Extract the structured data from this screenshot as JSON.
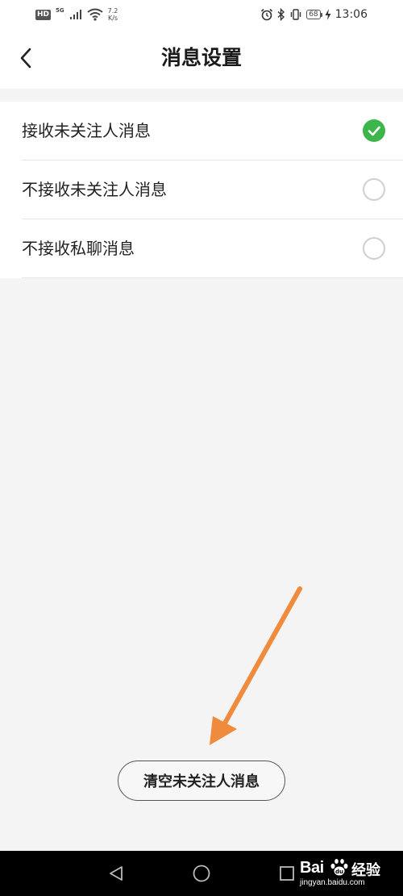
{
  "status_bar": {
    "hd": "HD",
    "network_gen": "5G",
    "speed_value": "7.2",
    "speed_unit": "K/s",
    "battery": "68",
    "time": "13:06"
  },
  "header": {
    "title": "消息设置"
  },
  "options": [
    {
      "label": "接收未关注人消息",
      "selected": true
    },
    {
      "label": "不接收未关注人消息",
      "selected": false
    },
    {
      "label": "不接收私聊消息",
      "selected": false
    }
  ],
  "clear_button": {
    "label": "清空未关注人消息"
  },
  "colors": {
    "accent_check": "#3cb54a",
    "annotation_arrow": "#f08a3c"
  },
  "watermark": {
    "brand": "Bai",
    "brand_suffix": "经验",
    "url": "jingyan.baidu.com"
  }
}
